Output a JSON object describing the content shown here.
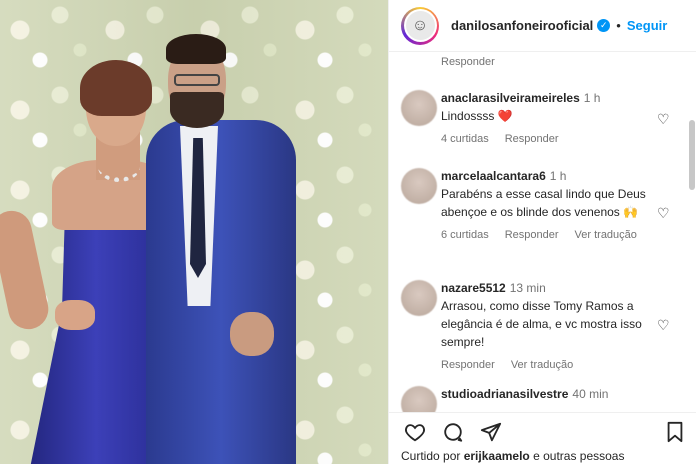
{
  "header": {
    "username": "danilosanfoneirooficial",
    "separator": "•",
    "follow_label": "Seguir",
    "avatar_icon": "☺"
  },
  "reply_top": "Responder",
  "comments": [
    {
      "username": "anaclarasilveirameireles",
      "time": "1 h",
      "text": "Lindossss ❤️",
      "likes": "4 curtidas",
      "reply": "Responder",
      "translate": ""
    },
    {
      "username": "marcelaalcantara6",
      "time": "1 h",
      "text": "Parabéns a esse casal lindo que Deus abençoe e os blinde dos venenos 🙌",
      "likes": "6 curtidas",
      "reply": "Responder",
      "translate": "Ver tradução"
    },
    {
      "username": "nazare5512",
      "time": "13 min",
      "text": "Arrasou, como disse Tomy Ramos a elegância é de alma, e vc mostra isso sempre!",
      "likes": "",
      "reply": "Responder",
      "translate": "Ver tradução"
    },
    {
      "username": "studioadrianasilvestre",
      "time": "40 min",
      "text": "",
      "likes": "",
      "reply": "",
      "translate": ""
    }
  ],
  "icons": {
    "heart": "♡",
    "comment": "◯",
    "share": "➤",
    "save": "🔖"
  },
  "liked_by": {
    "prefix": "Curtido por ",
    "user": "erijkaamelo",
    "suffix": " e outras pessoas"
  },
  "colors": {
    "accent": "#0095f6",
    "heart_red": "#ed4956",
    "muted": "#737373"
  }
}
